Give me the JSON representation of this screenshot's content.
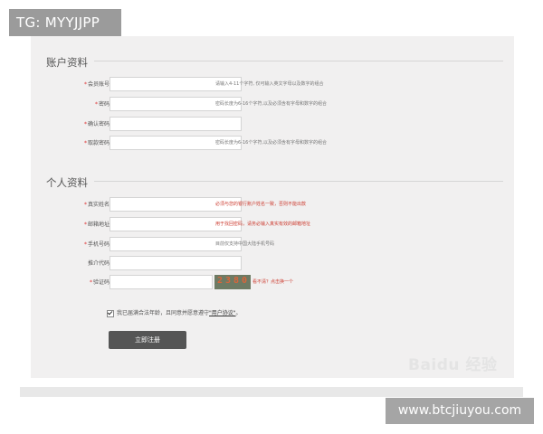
{
  "top_badge": "TG: MYYJJPP",
  "url_badge": "www.btcjiuyou.com",
  "watermark": "Baidu 经验",
  "account_section": {
    "title": "账户资料",
    "fields": [
      {
        "label": "会员账号",
        "required": true,
        "hint": "请输入4-11个字符, 仅可输入英文字母以及数字的组合",
        "hint_color": "gray"
      },
      {
        "label": "密码",
        "required": true,
        "hint": "密码长度为6-16个字符,以及必须含有字母和数字的组合",
        "hint_color": "gray"
      },
      {
        "label": "确认密码",
        "required": true,
        "hint": "",
        "hint_color": "gray"
      },
      {
        "label": "取款密码",
        "required": true,
        "hint": "密码长度为6-16个字符,以及必须含有字母和数字的组合",
        "hint_color": "gray"
      }
    ]
  },
  "personal_section": {
    "title": "个人资料",
    "fields": [
      {
        "label": "真实姓名",
        "required": true,
        "hint": "必须与您的银行账户姓名一致，否则不能出款",
        "hint_color": "red"
      },
      {
        "label": "邮箱地址",
        "required": true,
        "hint": "用于找回密码，请务必输入真实有效的邮箱地址",
        "hint_color": "red"
      },
      {
        "label": "手机号码",
        "required": true,
        "hint": "目前仅支持中国大陆手机号码",
        "hint_color": "gray"
      },
      {
        "label": "推介代码",
        "required": false,
        "hint": "",
        "hint_color": "gray"
      }
    ],
    "captcha": {
      "label": "验证码",
      "required": true,
      "image_text": "2380",
      "refresh_link": "看不清？点击换一个"
    }
  },
  "agreement": {
    "text": "我已届满合法年龄，且同意并愿意遵守",
    "link": "\"用户协议\"",
    "suffix": "。"
  },
  "submit_label": "立即注册"
}
